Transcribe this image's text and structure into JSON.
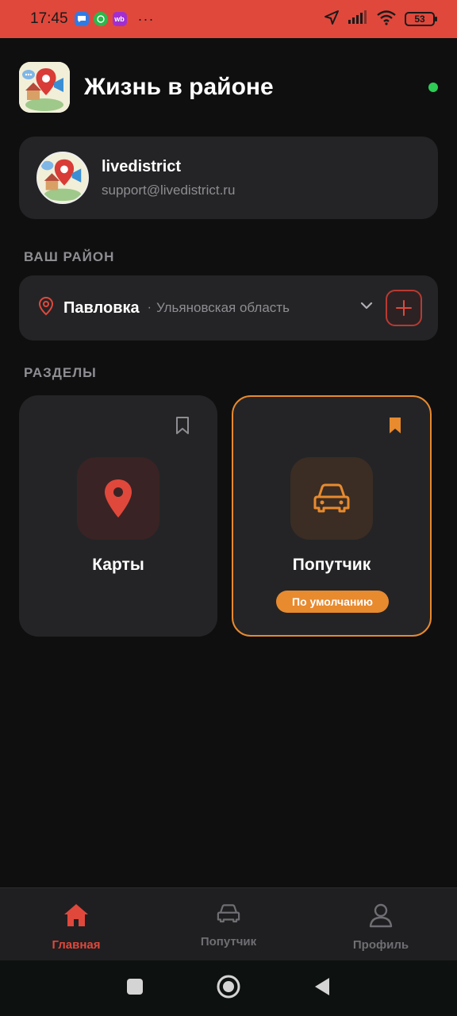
{
  "status_bar": {
    "time": "17:45",
    "apps": [
      {
        "name": "messages-icon",
        "color": "#2f7be6",
        "text": ""
      },
      {
        "name": "whatsapp-icon",
        "color": "#2bb84c",
        "text": ""
      },
      {
        "name": "wildberries-icon",
        "color": "#a12fcf",
        "text": "wb"
      }
    ],
    "more": "···",
    "battery": "53"
  },
  "header": {
    "title": "Жизнь в районе",
    "online_color": "#2ecc55"
  },
  "account": {
    "name": "livedistrict",
    "email": "support@livedistrict.ru"
  },
  "district": {
    "section_title": "ВАШ РАЙОН",
    "name": "Павловка",
    "separator": "·",
    "region": "Ульяновская область"
  },
  "sections": {
    "title": "РАЗДЕЛЫ",
    "items": [
      {
        "label": "Карты",
        "icon": "map-pin-icon",
        "bookmarked": false,
        "default": false
      },
      {
        "label": "Попутчик",
        "icon": "car-icon",
        "bookmarked": true,
        "default": true
      }
    ],
    "default_badge": "По умолчанию"
  },
  "bottom_nav": {
    "items": [
      {
        "label": "Главная",
        "icon": "home-icon",
        "active": true
      },
      {
        "label": "Попутчик",
        "icon": "car-icon",
        "active": false
      },
      {
        "label": "Профиль",
        "icon": "user-icon",
        "active": false
      }
    ]
  },
  "colors": {
    "accent": "#e0483c",
    "highlight": "#e88a2e",
    "card": "#242426",
    "background": "#0f0f10"
  }
}
